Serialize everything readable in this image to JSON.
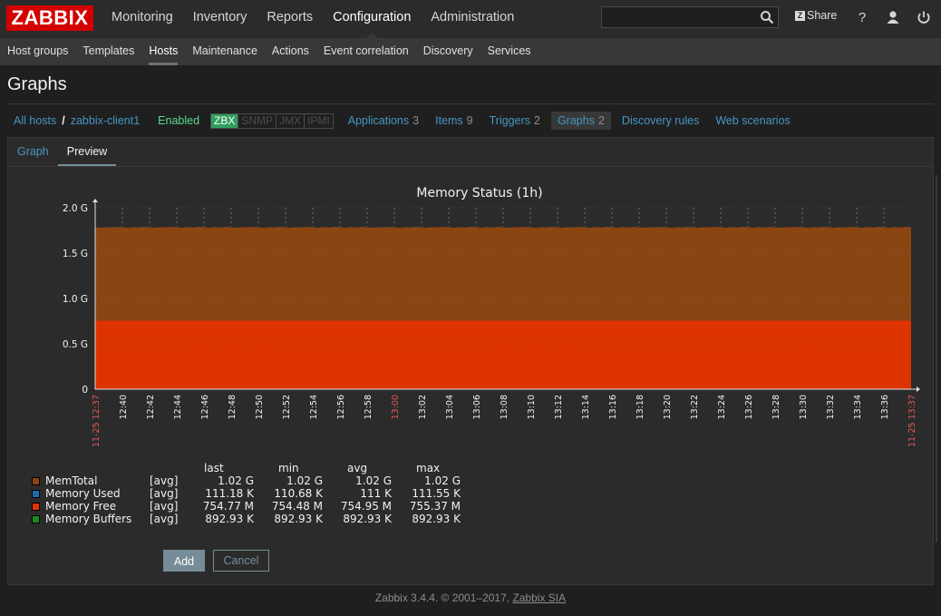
{
  "app": {
    "logo_text": "ZABBIX"
  },
  "main_menu": [
    {
      "label": "Monitoring"
    },
    {
      "label": "Inventory"
    },
    {
      "label": "Reports"
    },
    {
      "label": "Configuration",
      "active": true
    },
    {
      "label": "Administration"
    }
  ],
  "search": {
    "value": "",
    "placeholder": ""
  },
  "toolbar": {
    "share_label": "Share",
    "share_icon": "Z",
    "help_icon": "question-icon",
    "profile_icon": "user-icon",
    "logout_icon": "power-icon"
  },
  "sub_menu": [
    {
      "label": "Host groups"
    },
    {
      "label": "Templates"
    },
    {
      "label": "Hosts",
      "active": true
    },
    {
      "label": "Maintenance"
    },
    {
      "label": "Actions"
    },
    {
      "label": "Event correlation"
    },
    {
      "label": "Discovery"
    },
    {
      "label": "Services"
    }
  ],
  "page": {
    "title": "Graphs"
  },
  "host_nav": {
    "all_hosts": "All hosts",
    "separator": "/",
    "host": "zabbix-client1",
    "status": "Enabled",
    "availability": [
      "ZBX",
      "SNMP",
      "JMX",
      "IPMI"
    ],
    "applications": {
      "label": "Applications",
      "count": "3"
    },
    "items": {
      "label": "Items",
      "count": "9"
    },
    "triggers": {
      "label": "Triggers",
      "count": "2"
    },
    "graphs": {
      "label": "Graphs",
      "count": "2"
    },
    "discovery_rules": "Discovery rules",
    "web_scenarios": "Web scenarios"
  },
  "tabs": [
    {
      "label": "Graph"
    },
    {
      "label": "Preview",
      "active": true
    }
  ],
  "chart_data": {
    "type": "area",
    "title": "Memory Status (1h)",
    "stacked": true,
    "y_ticks": [
      "0",
      "0.5 G",
      "1.0 G",
      "1.5 G",
      "2.0 G"
    ],
    "ylim": [
      0,
      2.0
    ],
    "y_unit": "G",
    "x_start_label": "11-25 12:37",
    "x_end_label": "11-25 13:37",
    "x_ticks": [
      "12:40",
      "12:42",
      "12:44",
      "12:46",
      "12:48",
      "12:50",
      "12:52",
      "12:54",
      "12:56",
      "12:58",
      "13:00",
      "13:02",
      "13:04",
      "13:06",
      "13:08",
      "13:10",
      "13:12",
      "13:14",
      "13:16",
      "13:18",
      "13:20",
      "13:22",
      "13:24",
      "13:26",
      "13:28",
      "13:30",
      "13:32",
      "13:34",
      "13:36"
    ],
    "x_highlight_tick": "13:00",
    "grid": true,
    "legend_position": "bottom-left",
    "legend_columns": [
      "last",
      "min",
      "avg",
      "max"
    ],
    "series": [
      {
        "name": "MemTotal",
        "func": "[avg]",
        "color": "#8b4513",
        "last": "1.02 G",
        "min": "1.02 G",
        "avg": "1.02 G",
        "max": "1.02 G",
        "plot_level_g": 1.79
      },
      {
        "name": "Memory Used",
        "func": "[avg]",
        "color": "#1e6aa8",
        "last": "111.18 K",
        "min": "110.68 K",
        "avg": "111 K",
        "max": "111.55 K",
        "plot_level_g": 0.0001
      },
      {
        "name": "Memory Free",
        "func": "[avg]",
        "color": "#dd3300",
        "last": "754.77 M",
        "min": "754.48 M",
        "avg": "754.95 M",
        "max": "755.37 M",
        "plot_level_g": 0.755
      },
      {
        "name": "Memory Buffers",
        "func": "[avg]",
        "color": "#1a8c1a",
        "last": "892.93 K",
        "min": "892.93 K",
        "avg": "892.93 K",
        "max": "892.93 K",
        "plot_level_g": 0.0009
      }
    ]
  },
  "buttons": {
    "add": "Add",
    "cancel": "Cancel"
  },
  "footer": {
    "text": "Zabbix 3.4.4. © 2001–2017, ",
    "link": "Zabbix SIA"
  },
  "colors": {
    "accent": "#768d99",
    "link": "#4796c4",
    "enabled": "#59db8f",
    "logo": "#d40000"
  }
}
